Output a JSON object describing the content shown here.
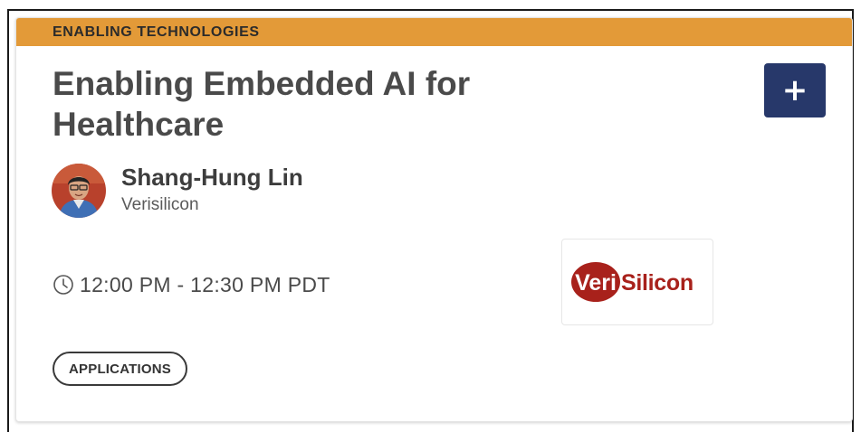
{
  "session": {
    "track": "ENABLING TECHNOLOGIES",
    "title": "Enabling Embedded AI for Healthcare",
    "add_button_label": "+",
    "speaker": {
      "name": "Shang-Hung Lin",
      "company": "Verisilicon"
    },
    "time": "12:00 PM - 12:30 PM PDT",
    "tag": "APPLICATIONS"
  },
  "sponsor": {
    "logo_prefix": "Veri",
    "logo_suffix": "Silicon"
  },
  "icons": {
    "clock": "clock-icon",
    "add": "plus-icon"
  },
  "colors": {
    "track_bar": "#e39a38",
    "add_button": "#27386a",
    "title_text": "#4a4a4a",
    "logo_red": "#a8211b"
  }
}
